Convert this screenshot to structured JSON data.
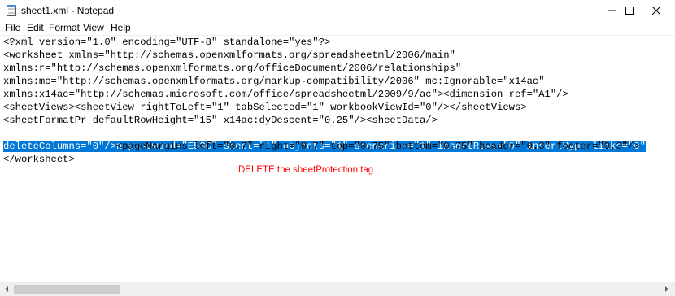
{
  "window": {
    "title": "sheet1.xml - Notepad",
    "controls": {
      "minimize": "—",
      "maximize": "☐",
      "close": "✕"
    }
  },
  "menu": [
    "File",
    "Edit",
    "Format",
    "View",
    "Help"
  ],
  "editor": {
    "lines": [
      "<?xml version=\"1.0\" encoding=\"UTF-8\" standalone=\"yes\"?>",
      "<worksheet xmlns=\"http://schemas.openxmlformats.org/spreadsheetml/2006/main\"",
      "xmlns:r=\"http://schemas.openxmlformats.org/officeDocument/2006/relationships\"",
      "xmlns:mc=\"http://schemas.openxmlformats.org/markup-compatibility/2006\" mc:Ignorable=\"x14ac\"",
      "xmlns:x14ac=\"http://schemas.microsoft.com/office/spreadsheetml/2009/9/ac\"><dimension ref=\"A1\"/>",
      "<sheetViews><sheetView rightToLeft=\"1\" tabSelected=\"1\" workbookViewId=\"0\"/></sheetViews>",
      "<sheetFormatPr defaultRowHeight=\"15\" x14ac:dyDescent=\"0.25\"/><sheetData/>"
    ],
    "selected_line_1": "<sheetProtection password=\"E53C\" sheet=\"1\" objects=\"1\" scenarios=\"1\" insertRows=\"0\" insertHyperlinks=\"0\"",
    "selected_line_2_sel": "deleteColumns=\"0\"/>",
    "selected_line_2_rest": "<pageMargins left=\"0.7\" right=\"0.7\" top=\"0.75\" bottom=\"0.75\" header=\"0.3\" footer=\"0.3\"/>",
    "last_line": "</worksheet>"
  },
  "annotation": "DELETE the sheetProtection tag",
  "colors": {
    "selection": "#0078d7",
    "annotation": "#ff0000"
  },
  "icons": [
    "notepad-icon",
    "minimize-icon",
    "maximize-icon",
    "close-icon",
    "scroll-left-icon",
    "scroll-right-icon"
  ]
}
